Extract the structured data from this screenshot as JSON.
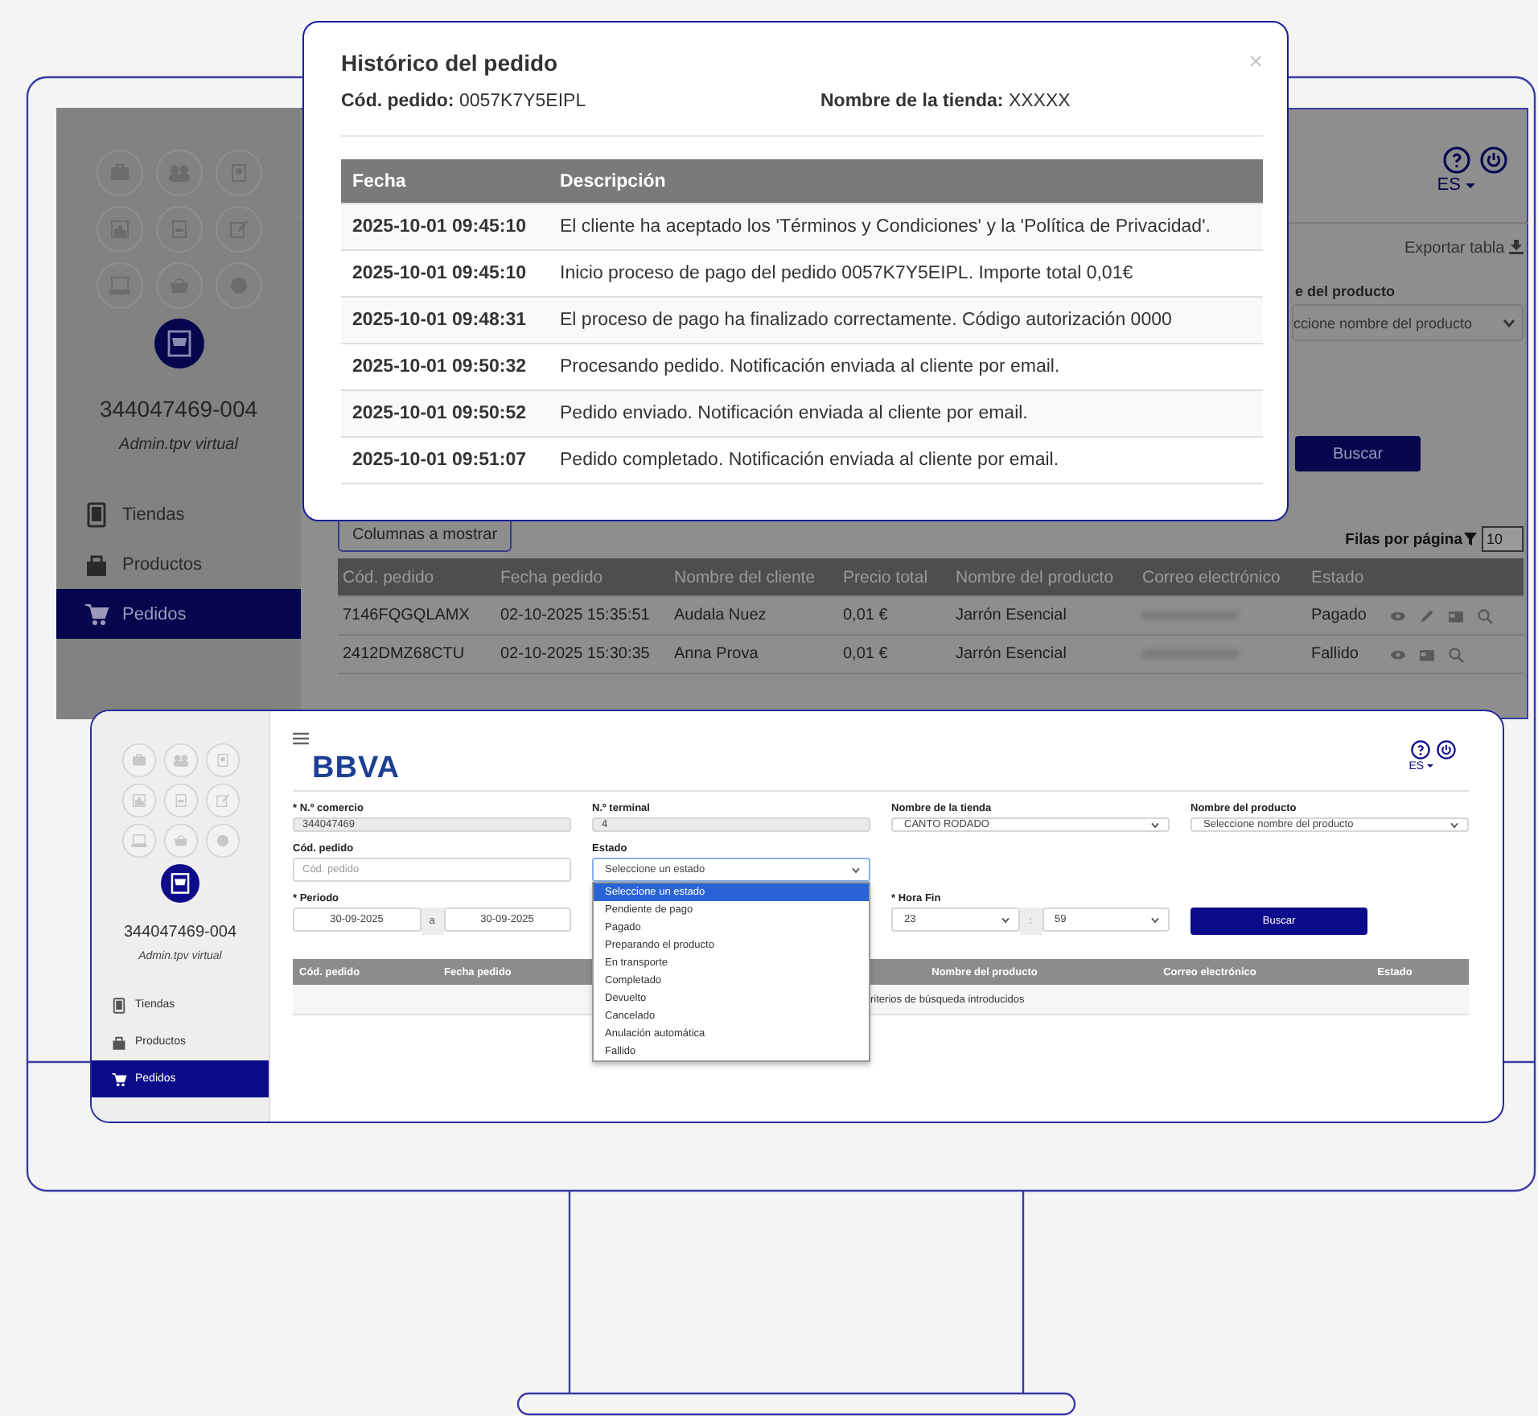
{
  "back_screen": {
    "sidebar": {
      "account": "344047469-004",
      "role": "Admin.tpv virtual",
      "items": [
        {
          "label": "Tiendas",
          "selected": false
        },
        {
          "label": "Productos",
          "selected": false
        },
        {
          "label": "Pedidos",
          "selected": true
        }
      ]
    },
    "header": {
      "language": "ES"
    },
    "export_link": "Exportar tabla",
    "filter_label": "e del producto",
    "filter_select": "ccione nombre del producto",
    "search_button": "Buscar",
    "columns_button": "Columnas a mostrar",
    "rows_per_page": {
      "label": "Filas por página",
      "value": "10"
    },
    "table": {
      "columns": [
        "Cód. pedido",
        "Fecha pedido",
        "Nombre del cliente",
        "Precio total",
        "Nombre del producto",
        "Correo electrónico",
        "Estado"
      ],
      "rows": [
        {
          "cells": [
            "7146FQGQLAMX",
            "02-10-2025 15:35:51",
            "Audala Nuez",
            "0,01 €",
            "Jarrón Esencial"
          ],
          "status": "Pagado",
          "editable": true
        },
        {
          "cells": [
            "2412DMZ68CTU",
            "02-10-2025 15:30:35",
            "Anna Prova",
            "0,01 €",
            "Jarrón Esencial"
          ],
          "status": "Fallido",
          "editable": false
        }
      ]
    }
  },
  "modal": {
    "title": "Histórico del pedido",
    "close": "×",
    "order_code": "**Cód. pedido:** 0057K7Y5EIPL",
    "store_name": "**Nombre de la tienda:** XXXXX",
    "columns": [
      "Fecha",
      "Descripción"
    ],
    "rows": [
      {
        "date": "2025-10-01 09:45:10",
        "description": "El cliente ha aceptado los 'Términos y Condiciones' y la 'Política de Privacidad'."
      },
      {
        "date": "2025-10-01 09:45:10",
        "description": "Inicio proceso de pago del pedido 0057K7Y5EIPL. Importe total 0,01€"
      },
      {
        "date": "2025-10-01 09:48:31",
        "description": "El proceso de pago ha finalizado correctamente. Código autorización 0000"
      },
      {
        "date": "2025-10-01 09:50:32",
        "description": "Procesando pedido. Notificación enviada al cliente por email."
      },
      {
        "date": "2025-10-01 09:50:52",
        "description": "Pedido enviado. Notificación enviada al cliente por email."
      },
      {
        "date": "2025-10-01 09:51:07",
        "description": "Pedido completado. Notificación enviada al cliente por email."
      }
    ]
  },
  "front_window": {
    "sidebar": {
      "account": "344047469-004",
      "role": "Admin.tpv virtual",
      "items": [
        {
          "label": "Tiendas",
          "selected": false
        },
        {
          "label": "Productos",
          "selected": false
        },
        {
          "label": "Pedidos",
          "selected": true
        }
      ]
    },
    "logo": "BBVA",
    "language": "ES",
    "form_rows": [
      [
        {
          "kind": "input",
          "label": "* N.º comercio",
          "value": "344047469",
          "disabled": true
        },
        {
          "kind": "input",
          "label": "N.º terminal",
          "value": "4",
          "disabled": true
        },
        {
          "kind": "select",
          "label": "Nombre de la tienda",
          "value": "CANTO RODADO"
        },
        {
          "kind": "select",
          "label": "Nombre del producto",
          "placeholder": "Seleccione nombre del producto"
        }
      ],
      [
        {
          "kind": "input",
          "label": "Cód. pedido",
          "placeholder": "Cód. pedido",
          "disabled": false
        },
        {
          "kind": "dropdown",
          "label": "Estado",
          "value": "Seleccione un estado",
          "options": [
            {
              "label": "Seleccione un estado",
              "selected": true
            },
            {
              "label": "Pendiente de pago",
              "selected": false
            },
            {
              "label": "Pagado",
              "selected": false
            },
            {
              "label": "Preparando el producto",
              "selected": false
            },
            {
              "label": "En transporte",
              "selected": false
            },
            {
              "label": "Completado",
              "selected": false
            },
            {
              "label": "Devuelto",
              "selected": false
            },
            {
              "label": "Cancelado",
              "selected": false
            },
            {
              "label": "Anulación automática",
              "selected": false
            },
            {
              "label": "Fallido",
              "selected": false
            }
          ]
        }
      ],
      [
        {
          "kind": "date-range",
          "label": "* Periodo",
          "from": "30-09-2025",
          "separator": "a",
          "to": "30-09-2025"
        },
        {
          "kind": "time-range",
          "label": "* Hora Fin",
          "hour": "23",
          "separator": ":",
          "minute": "59"
        },
        {
          "kind": "button",
          "label": "Buscar"
        }
      ]
    ],
    "table": {
      "columns": [
        "Cód. pedido",
        "Fecha pedido",
        "Nombre del producto",
        "Correo electrónico",
        "Estado"
      ],
      "message": "riterios de búsqueda introducidos"
    }
  }
}
